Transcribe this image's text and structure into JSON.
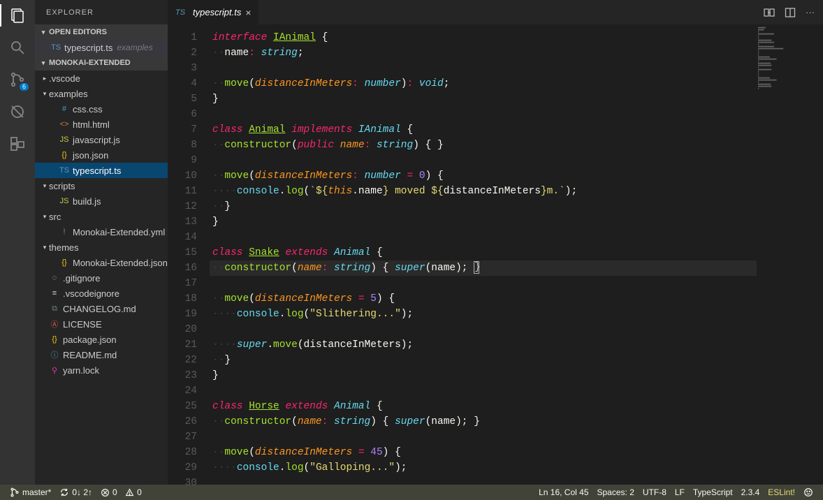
{
  "sidebar": {
    "title": "EXPLORER",
    "openEditorsHeader": "OPEN EDITORS",
    "openEditors": [
      {
        "name": "typescript.ts",
        "sub": "examples",
        "iconCls": "c-ts",
        "icon": "TS"
      }
    ],
    "workspaceHeader": "MONOKAI-EXTENDED",
    "tree": [
      {
        "depth": 0,
        "kind": "folder",
        "open": false,
        "name": ".vscode"
      },
      {
        "depth": 0,
        "kind": "folder",
        "open": true,
        "name": "examples"
      },
      {
        "depth": 1,
        "kind": "file",
        "name": "css.css",
        "icon": "#",
        "iconCls": "c-css"
      },
      {
        "depth": 1,
        "kind": "file",
        "name": "html.html",
        "icon": "<>",
        "iconCls": "c-html"
      },
      {
        "depth": 1,
        "kind": "file",
        "name": "javascript.js",
        "icon": "JS",
        "iconCls": "c-js"
      },
      {
        "depth": 1,
        "kind": "file",
        "name": "json.json",
        "icon": "{}",
        "iconCls": "c-json"
      },
      {
        "depth": 1,
        "kind": "file",
        "name": "typescript.ts",
        "icon": "TS",
        "iconCls": "c-ts",
        "selected": true
      },
      {
        "depth": 0,
        "kind": "folder",
        "open": true,
        "name": "scripts"
      },
      {
        "depth": 1,
        "kind": "file",
        "name": "build.js",
        "icon": "JS",
        "iconCls": "c-js"
      },
      {
        "depth": 0,
        "kind": "folder",
        "open": true,
        "name": "src"
      },
      {
        "depth": 1,
        "kind": "file",
        "name": "Monokai-Extended.yml",
        "icon": "!",
        "iconCls": "c-yml"
      },
      {
        "depth": 0,
        "kind": "folder",
        "open": true,
        "name": "themes"
      },
      {
        "depth": 1,
        "kind": "file",
        "name": "Monokai-Extended.json",
        "icon": "{}",
        "iconCls": "c-json"
      },
      {
        "depth": 0,
        "kind": "file",
        "name": ".gitignore",
        "icon": "◌",
        "iconCls": "c-git",
        "noIndent": true
      },
      {
        "depth": 0,
        "kind": "file",
        "name": ".vscodeignore",
        "icon": "≡",
        "iconCls": "c-git",
        "noIndent": true
      },
      {
        "depth": 0,
        "kind": "file",
        "name": "CHANGELOG.md",
        "icon": "⧉",
        "iconCls": "c-md",
        "noIndent": true
      },
      {
        "depth": 0,
        "kind": "file",
        "name": "LICENSE",
        "icon": "Ⓐ",
        "iconCls": "c-lic",
        "noIndent": true
      },
      {
        "depth": 0,
        "kind": "file",
        "name": "package.json",
        "icon": "{}",
        "iconCls": "c-json",
        "noIndent": true
      },
      {
        "depth": 0,
        "kind": "file",
        "name": "README.md",
        "icon": "ⓘ",
        "iconCls": "c-info",
        "noIndent": true
      },
      {
        "depth": 0,
        "kind": "file",
        "name": "yarn.lock",
        "icon": "⚲",
        "iconCls": "c-lock",
        "noIndent": true
      }
    ]
  },
  "scmBadge": "6",
  "tab": {
    "icon": "TS",
    "name": "typescript.ts"
  },
  "code": {
    "lines": [
      [
        [
          "kw",
          "interface"
        ],
        [
          "pn",
          " "
        ],
        [
          "cls",
          "IAnimal"
        ],
        [
          "pn",
          " {"
        ]
      ],
      [
        [
          "ig",
          "··"
        ],
        [
          "prop",
          "name"
        ],
        [
          "op",
          ":"
        ],
        [
          "pn",
          " "
        ],
        [
          "typ",
          "string"
        ],
        [
          "pn",
          ";"
        ]
      ],
      [],
      [
        [
          "ig",
          "··"
        ],
        [
          "fn",
          "move"
        ],
        [
          "pn",
          "("
        ],
        [
          "prm",
          "distanceInMeters"
        ],
        [
          "op",
          ":"
        ],
        [
          "pn",
          " "
        ],
        [
          "typ",
          "number"
        ],
        [
          "pn",
          ")"
        ],
        [
          "op",
          ":"
        ],
        [
          "pn",
          " "
        ],
        [
          "typ",
          "void"
        ],
        [
          "pn",
          ";"
        ]
      ],
      [
        [
          "pn",
          "}"
        ]
      ],
      [],
      [
        [
          "kw",
          "class"
        ],
        [
          "pn",
          " "
        ],
        [
          "cls",
          "Animal"
        ],
        [
          "pn",
          " "
        ],
        [
          "kw",
          "implements"
        ],
        [
          "pn",
          " "
        ],
        [
          "clsr",
          "IAnimal"
        ],
        [
          "pn",
          " {"
        ]
      ],
      [
        [
          "ig",
          "··"
        ],
        [
          "fn",
          "constructor"
        ],
        [
          "pn",
          "("
        ],
        [
          "kw",
          "public"
        ],
        [
          "pn",
          " "
        ],
        [
          "prm",
          "name"
        ],
        [
          "op",
          ":"
        ],
        [
          "pn",
          " "
        ],
        [
          "typ",
          "string"
        ],
        [
          "pn",
          ") { }"
        ]
      ],
      [],
      [
        [
          "ig",
          "··"
        ],
        [
          "fn",
          "move"
        ],
        [
          "pn",
          "("
        ],
        [
          "prm",
          "distanceInMeters"
        ],
        [
          "op",
          ":"
        ],
        [
          "pn",
          " "
        ],
        [
          "typ",
          "number"
        ],
        [
          "pn",
          " "
        ],
        [
          "op",
          "="
        ],
        [
          "pn",
          " "
        ],
        [
          "num",
          "0"
        ],
        [
          "pn",
          ") {"
        ]
      ],
      [
        [
          "ig",
          "····"
        ],
        [
          "obj",
          "console"
        ],
        [
          "pn",
          "."
        ],
        [
          "fn",
          "log"
        ],
        [
          "pn",
          "("
        ],
        [
          "str",
          "`${"
        ],
        [
          "this",
          "this"
        ],
        [
          "pn",
          "."
        ],
        [
          "prop",
          "name"
        ],
        [
          "str",
          "} moved ${"
        ],
        [
          "prop",
          "distanceInMeters"
        ],
        [
          "str",
          "}m.`"
        ],
        [
          "pn",
          ");"
        ]
      ],
      [
        [
          "ig",
          "··"
        ],
        [
          "pn",
          "}"
        ]
      ],
      [
        [
          "pn",
          "}"
        ]
      ],
      [],
      [
        [
          "kw",
          "class"
        ],
        [
          "pn",
          " "
        ],
        [
          "cls",
          "Snake"
        ],
        [
          "pn",
          " "
        ],
        [
          "kw",
          "extends"
        ],
        [
          "pn",
          " "
        ],
        [
          "clsr",
          "Animal"
        ],
        [
          "pn",
          " {"
        ]
      ],
      [
        [
          "ig",
          "··"
        ],
        [
          "fn",
          "constructor"
        ],
        [
          "pn",
          "("
        ],
        [
          "prm",
          "name"
        ],
        [
          "op",
          ":"
        ],
        [
          "pn",
          " "
        ],
        [
          "typ",
          "string"
        ],
        [
          "pn",
          ") "
        ],
        [
          "pn",
          "{"
        ],
        [
          "pn",
          " "
        ],
        [
          "kw2",
          "super"
        ],
        [
          "pn",
          "(name); "
        ],
        [
          "cursor",
          "}"
        ]
      ],
      [],
      [
        [
          "ig",
          "··"
        ],
        [
          "fn",
          "move"
        ],
        [
          "pn",
          "("
        ],
        [
          "prm",
          "distanceInMeters"
        ],
        [
          "pn",
          " "
        ],
        [
          "op",
          "="
        ],
        [
          "pn",
          " "
        ],
        [
          "num",
          "5"
        ],
        [
          "pn",
          ") {"
        ]
      ],
      [
        [
          "ig",
          "····"
        ],
        [
          "obj",
          "console"
        ],
        [
          "pn",
          "."
        ],
        [
          "fn",
          "log"
        ],
        [
          "pn",
          "("
        ],
        [
          "str",
          "\"Slithering...\""
        ],
        [
          "pn",
          ");"
        ]
      ],
      [],
      [
        [
          "ig",
          "····"
        ],
        [
          "kw2",
          "super"
        ],
        [
          "pn",
          "."
        ],
        [
          "fn",
          "move"
        ],
        [
          "pn",
          "(distanceInMeters);"
        ]
      ],
      [
        [
          "ig",
          "··"
        ],
        [
          "pn",
          "}"
        ]
      ],
      [
        [
          "pn",
          "}"
        ]
      ],
      [],
      [
        [
          "kw",
          "class"
        ],
        [
          "pn",
          " "
        ],
        [
          "cls",
          "Horse"
        ],
        [
          "pn",
          " "
        ],
        [
          "kw",
          "extends"
        ],
        [
          "pn",
          " "
        ],
        [
          "clsr",
          "Animal"
        ],
        [
          "pn",
          " {"
        ]
      ],
      [
        [
          "ig",
          "··"
        ],
        [
          "fn",
          "constructor"
        ],
        [
          "pn",
          "("
        ],
        [
          "prm",
          "name"
        ],
        [
          "op",
          ":"
        ],
        [
          "pn",
          " "
        ],
        [
          "typ",
          "string"
        ],
        [
          "pn",
          ") { "
        ],
        [
          "kw2",
          "super"
        ],
        [
          "pn",
          "(name); }"
        ]
      ],
      [],
      [
        [
          "ig",
          "··"
        ],
        [
          "fn",
          "move"
        ],
        [
          "pn",
          "("
        ],
        [
          "prm",
          "distanceInMeters"
        ],
        [
          "pn",
          " "
        ],
        [
          "op",
          "="
        ],
        [
          "pn",
          " "
        ],
        [
          "num",
          "45"
        ],
        [
          "pn",
          ") {"
        ]
      ],
      [
        [
          "ig",
          "····"
        ],
        [
          "obj",
          "console"
        ],
        [
          "pn",
          "."
        ],
        [
          "fn",
          "log"
        ],
        [
          "pn",
          "("
        ],
        [
          "str",
          "\"Galloping...\""
        ],
        [
          "pn",
          ");"
        ]
      ],
      []
    ],
    "highlightLine": 16
  },
  "status": {
    "branch": "master*",
    "sync": "0↓ 2↑",
    "errors": "0",
    "warnings": "0",
    "lncol": "Ln 16, Col 45",
    "spaces": "Spaces: 2",
    "encoding": "UTF-8",
    "eol": "LF",
    "lang": "TypeScript",
    "tsver": "2.3.4",
    "eslint": "ESLint!"
  }
}
